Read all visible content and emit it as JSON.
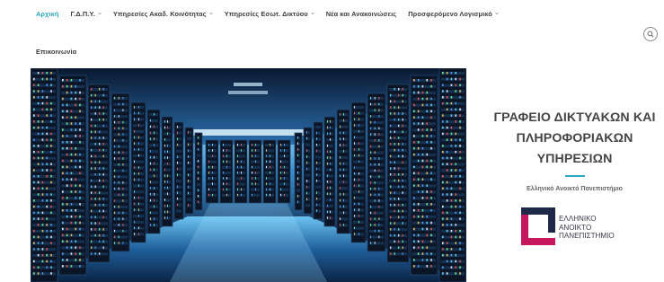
{
  "nav": {
    "items": [
      {
        "label": "Αρχική",
        "active": true,
        "has_dropdown": false
      },
      {
        "label": "Γ.Δ.Π.Υ.",
        "active": false,
        "has_dropdown": true
      },
      {
        "label": "Υπηρεσίες Ακαδ. Κοινότητας",
        "active": false,
        "has_dropdown": true
      },
      {
        "label": "Υπηρεσίες Εσωτ. Δικτύου",
        "active": false,
        "has_dropdown": true
      },
      {
        "label": "Νέα και Ανακοινώσεις",
        "active": false,
        "has_dropdown": false
      },
      {
        "label": "Προσφερόμενο Λογισμικό",
        "active": false,
        "has_dropdown": true
      }
    ],
    "second_row": {
      "label": "Επικοινωνία"
    },
    "search_icon": "search-icon"
  },
  "colors": {
    "accent": "#2aa7c1",
    "text": "#3d3d3d",
    "logo_navy": "#1f2a4a",
    "logo_magenta": "#c4175e"
  },
  "side": {
    "title_lines": [
      "ΓΡΑΦΕΙΟ ΔΙΚΤΥΑΚΩΝ ΚΑΙ",
      "ΠΛΗΡΟΦΟΡΙΑΚΩΝ",
      "ΥΠΗΡΕΣΙΩΝ"
    ],
    "subtitle": "Ελληνικό Ανοικτό Πανεπιστήμιο"
  },
  "logo": {
    "lines": [
      "ΕΛΛΗΝΙΚΟ",
      "ΑΝΟΙΚΤΟ",
      "ΠΑΝΕΠΙΣΤΗΜΙΟ"
    ]
  },
  "hero": {
    "image": "server-room-photo"
  }
}
